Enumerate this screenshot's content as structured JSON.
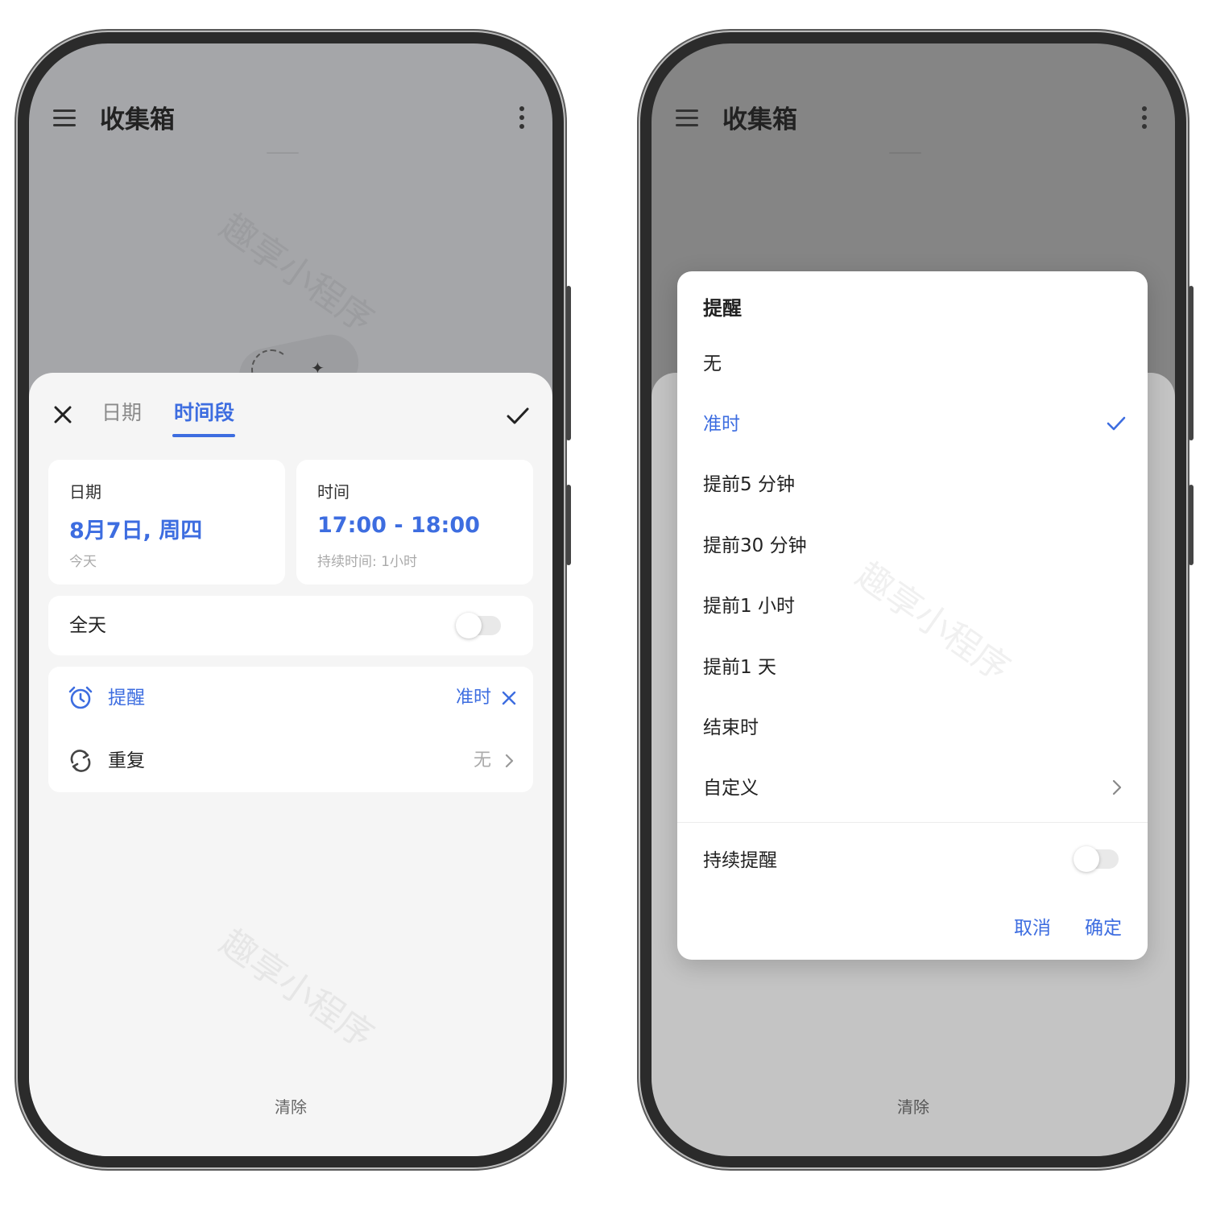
{
  "app": {
    "title": "收集箱",
    "watermark": "趣享小程序"
  },
  "sheet": {
    "tabs": {
      "date": "日期",
      "range": "时间段"
    },
    "date_card": {
      "label": "日期",
      "value": "8月7日, 周四",
      "sub": "今天"
    },
    "time_card": {
      "label": "时间",
      "value": "17:00 - 18:00",
      "sub": "持续时间: 1小时"
    },
    "all_day": {
      "label": "全天",
      "on": false
    },
    "reminder": {
      "label": "提醒",
      "value": "准时"
    },
    "repeat": {
      "label": "重复",
      "value": "无"
    },
    "clear": "清除"
  },
  "dialog": {
    "title": "提醒",
    "options": [
      "无",
      "准时",
      "提前5 分钟",
      "提前30 分钟",
      "提前1 小时",
      "提前1 天",
      "结束时",
      "自定义"
    ],
    "selected": "准时",
    "persistent": {
      "label": "持续提醒",
      "on": false
    },
    "cancel": "取消",
    "ok": "确定"
  },
  "colors": {
    "accent": "#3d6de0",
    "sheet_bg": "#f5f5f5"
  },
  "icons": [
    "menu-icon",
    "more-icon",
    "close-icon",
    "check-icon",
    "alarm-icon",
    "repeat-icon",
    "chevron-right-icon"
  ]
}
